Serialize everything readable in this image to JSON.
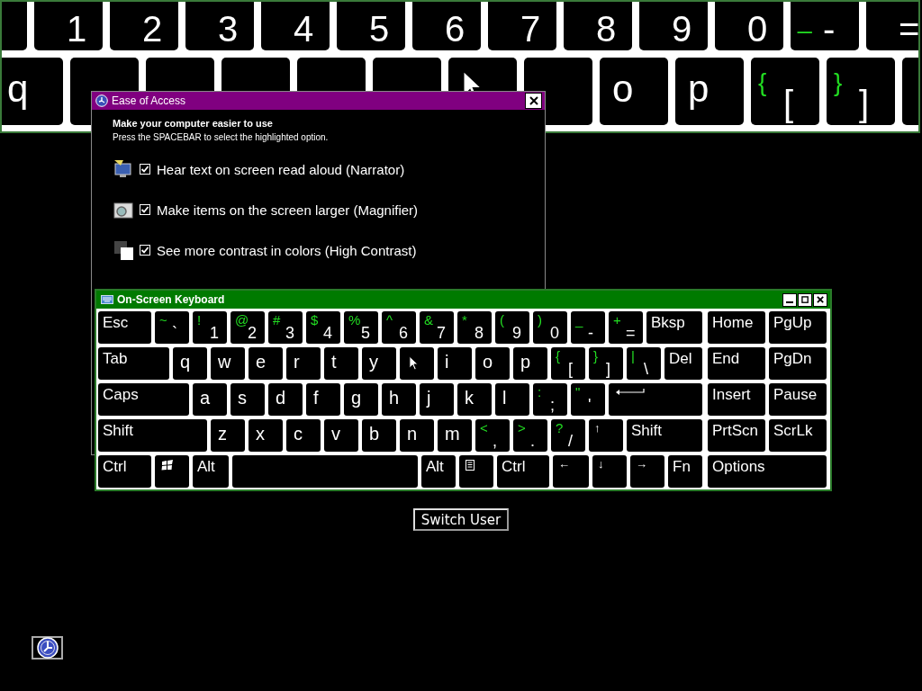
{
  "magnifier": {
    "rows": [
      [
        {
          "kind": "blank"
        },
        {
          "kind": "char",
          "base": "1"
        },
        {
          "kind": "char",
          "base": "2"
        },
        {
          "kind": "char",
          "base": "3"
        },
        {
          "kind": "char",
          "base": "4"
        },
        {
          "kind": "char",
          "base": "5"
        },
        {
          "kind": "char",
          "base": "6"
        },
        {
          "kind": "char",
          "base": "7"
        },
        {
          "kind": "char",
          "base": "8"
        },
        {
          "kind": "char",
          "base": "9"
        },
        {
          "kind": "char",
          "base": "0"
        },
        {
          "kind": "char",
          "shift": "_",
          "base": "-"
        },
        {
          "kind": "char",
          "base": "="
        }
      ],
      [
        {
          "kind": "char",
          "base": "q"
        },
        {
          "kind": "blank"
        },
        {
          "kind": "blank"
        },
        {
          "kind": "blank"
        },
        {
          "kind": "blank"
        },
        {
          "kind": "blank"
        },
        {
          "kind": "covered"
        },
        {
          "kind": "blank"
        },
        {
          "kind": "char",
          "base": "o"
        },
        {
          "kind": "char",
          "base": "p"
        },
        {
          "kind": "char",
          "shift": "{",
          "base": "["
        },
        {
          "kind": "char",
          "shift": "}",
          "base": "]"
        },
        {
          "kind": "blank"
        }
      ]
    ]
  },
  "ease_of_access": {
    "title": "Ease of Access",
    "heading": "Make your computer easier to use",
    "instruction": "Press the SPACEBAR to select the highlighted option.",
    "options": [
      {
        "kind": "narrator",
        "label": "Hear text on screen read aloud (Narrator)",
        "checked": true
      },
      {
        "kind": "magnifier",
        "label": "Make items on the screen larger (Magnifier)",
        "checked": true
      },
      {
        "kind": "contrast",
        "label": "See more contrast in colors (High Contrast)",
        "checked": true
      }
    ]
  },
  "keyboard": {
    "title": "On-Screen Keyboard",
    "rows": [
      {
        "main": [
          {
            "kind": "label",
            "label": "Esc"
          },
          {
            "kind": "char",
            "shift": "~",
            "base": "`"
          },
          {
            "kind": "char",
            "shift": "!",
            "base": "1"
          },
          {
            "kind": "char",
            "shift": "@",
            "base": "2"
          },
          {
            "kind": "char",
            "shift": "#",
            "base": "3"
          },
          {
            "kind": "char",
            "shift": "$",
            "base": "4"
          },
          {
            "kind": "char",
            "shift": "%",
            "base": "5"
          },
          {
            "kind": "char",
            "shift": "^",
            "base": "6"
          },
          {
            "kind": "char",
            "shift": "&",
            "base": "7"
          },
          {
            "kind": "char",
            "shift": "*",
            "base": "8"
          },
          {
            "kind": "char",
            "shift": "(",
            "base": "9"
          },
          {
            "kind": "char",
            "shift": ")",
            "base": "0"
          },
          {
            "kind": "char",
            "shift": "_",
            "base": "-"
          },
          {
            "kind": "char",
            "shift": "+",
            "base": "="
          },
          {
            "kind": "label",
            "label": "Bksp"
          }
        ],
        "side": [
          {
            "kind": "label",
            "label": "Home"
          },
          {
            "kind": "label",
            "label": "PgUp"
          }
        ]
      },
      {
        "main": [
          {
            "kind": "label",
            "label": "Tab"
          },
          {
            "kind": "char",
            "base": "q"
          },
          {
            "kind": "char",
            "base": "w"
          },
          {
            "kind": "char",
            "base": "e"
          },
          {
            "kind": "char",
            "base": "r"
          },
          {
            "kind": "char",
            "base": "t"
          },
          {
            "kind": "char",
            "base": "y"
          },
          {
            "kind": "covered"
          },
          {
            "kind": "char",
            "base": "i"
          },
          {
            "kind": "char",
            "base": "o"
          },
          {
            "kind": "char",
            "base": "p"
          },
          {
            "kind": "char",
            "shift": "{",
            "base": "["
          },
          {
            "kind": "char",
            "shift": "}",
            "base": "]"
          },
          {
            "kind": "char",
            "shift": "|",
            "base": "\\"
          },
          {
            "kind": "label",
            "label": "Del"
          }
        ],
        "side": [
          {
            "kind": "label",
            "label": "End"
          },
          {
            "kind": "label",
            "label": "PgDn"
          }
        ]
      },
      {
        "main": [
          {
            "kind": "label",
            "label": "Caps"
          },
          {
            "kind": "char",
            "base": "a"
          },
          {
            "kind": "char",
            "base": "s"
          },
          {
            "kind": "char",
            "base": "d"
          },
          {
            "kind": "char",
            "base": "f"
          },
          {
            "kind": "char",
            "base": "g"
          },
          {
            "kind": "char",
            "base": "h"
          },
          {
            "kind": "char",
            "base": "j"
          },
          {
            "kind": "char",
            "base": "k"
          },
          {
            "kind": "char",
            "base": "l"
          },
          {
            "kind": "char",
            "shift": ":",
            "base": ";"
          },
          {
            "kind": "char",
            "shift": "\"",
            "base": "'"
          },
          {
            "kind": "enter"
          }
        ],
        "side": [
          {
            "kind": "label",
            "label": "Insert"
          },
          {
            "kind": "label",
            "label": "Pause"
          }
        ]
      },
      {
        "main": [
          {
            "kind": "label",
            "label": "Shift"
          },
          {
            "kind": "char",
            "base": "z"
          },
          {
            "kind": "char",
            "base": "x"
          },
          {
            "kind": "char",
            "base": "c"
          },
          {
            "kind": "char",
            "base": "v"
          },
          {
            "kind": "char",
            "base": "b"
          },
          {
            "kind": "char",
            "base": "n"
          },
          {
            "kind": "char",
            "base": "m"
          },
          {
            "kind": "char",
            "shift": "<",
            "base": ","
          },
          {
            "kind": "char",
            "shift": ">",
            "base": "."
          },
          {
            "kind": "char",
            "shift": "?",
            "base": "/"
          },
          {
            "kind": "arrow",
            "label": "↑"
          },
          {
            "kind": "label",
            "label": "Shift"
          }
        ],
        "side": [
          {
            "kind": "label",
            "label": "PrtScn"
          },
          {
            "kind": "label",
            "label": "ScrLk"
          }
        ]
      },
      {
        "main": [
          {
            "kind": "label",
            "label": "Ctrl"
          },
          {
            "kind": "windows"
          },
          {
            "kind": "label",
            "label": "Alt"
          },
          {
            "kind": "space"
          },
          {
            "kind": "label",
            "label": "Alt"
          },
          {
            "kind": "menu"
          },
          {
            "kind": "label",
            "label": "Ctrl"
          },
          {
            "kind": "arrow",
            "label": "←"
          },
          {
            "kind": "arrow",
            "label": "↓"
          },
          {
            "kind": "arrow",
            "label": "→"
          },
          {
            "kind": "label",
            "label": "Fn"
          }
        ],
        "side": [
          {
            "kind": "label",
            "label": "Options"
          }
        ]
      }
    ]
  },
  "switch_user": "Switch User"
}
